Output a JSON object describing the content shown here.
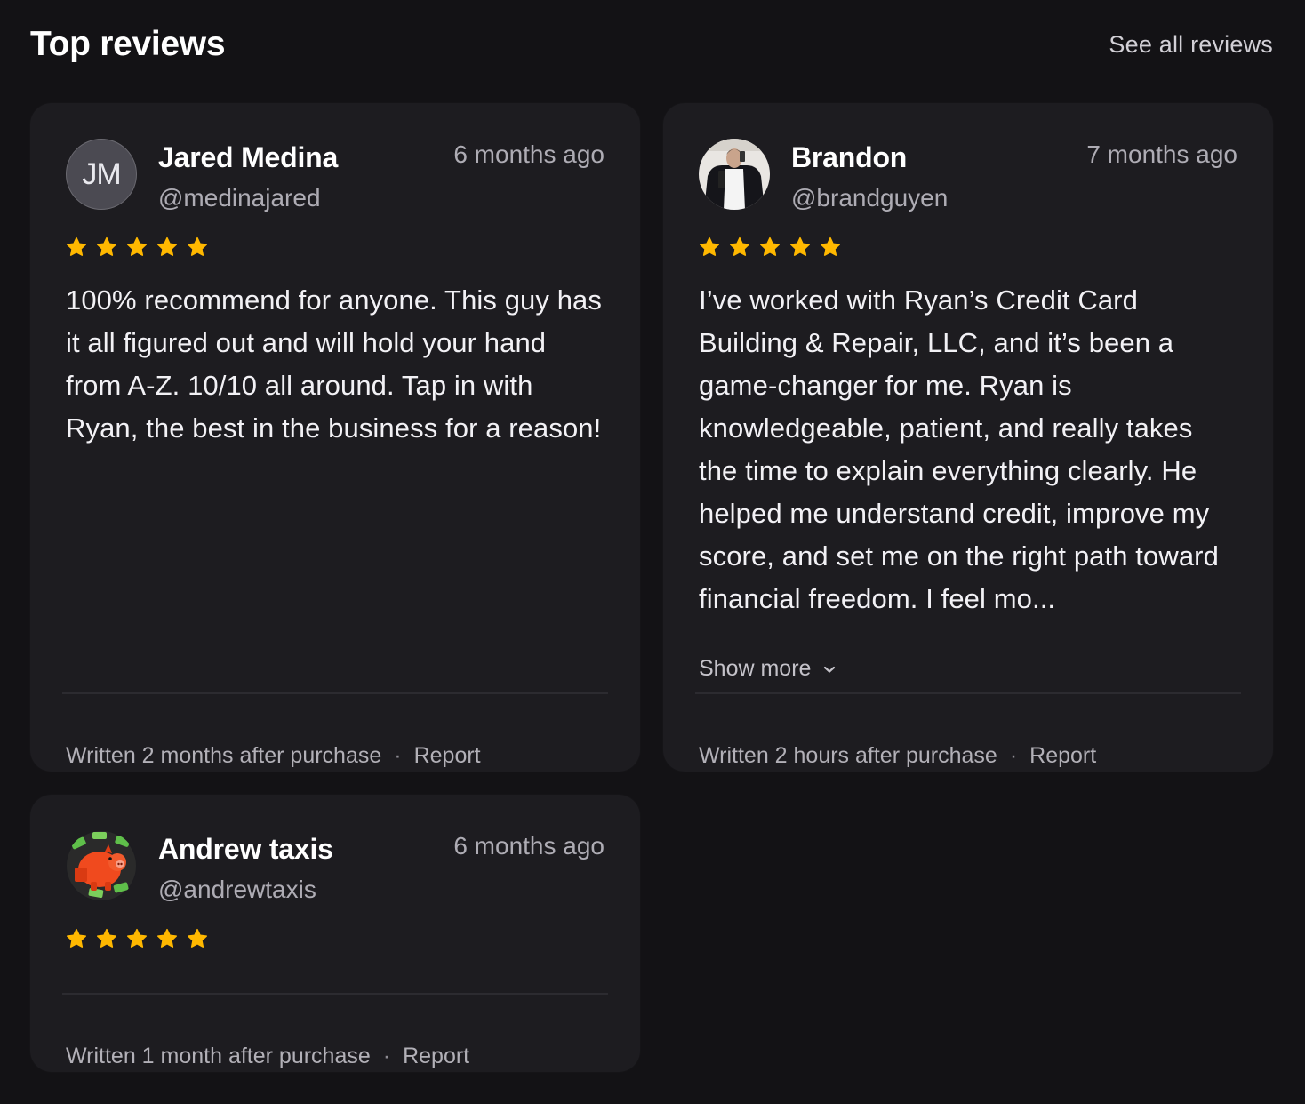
{
  "header": {
    "title": "Top reviews",
    "see_all": "See all reviews"
  },
  "reviews": [
    {
      "avatar_initials": "JM",
      "name": "Jared Medina",
      "handle": "@medinajared",
      "time": "6 months ago",
      "rating": 5,
      "text": "100% recommend for anyone. This guy has it all figured out and will hold your hand from A-Z. 10/10 all around. Tap in with Ryan, the best in the business for a reason!",
      "footer": "Written 2 months after purchase",
      "report": "Report"
    },
    {
      "avatar_initials": "",
      "name": "Brandon",
      "handle": "@brandguyen",
      "time": "7 months ago",
      "rating": 5,
      "text": "I’ve worked with Ryan’s Credit Card Building & Repair, LLC, and it’s been a game-changer for me. Ryan is knowledgeable, patient, and really takes the time to explain everything clearly. He helped me understand credit, improve my score, and set me on the right path toward financial freedom. I feel mo...",
      "show_more": "Show more",
      "footer": "Written 2 hours after purchase",
      "report": "Report"
    },
    {
      "avatar_initials": "",
      "name": "Andrew taxis",
      "handle": "@andrewtaxis",
      "time": "6 months ago",
      "rating": 5,
      "text": "",
      "footer": "Written 1 month after purchase",
      "report": "Report"
    }
  ],
  "colors": {
    "background": "#131215",
    "card": "#1d1c20",
    "star": "#ffb800",
    "muted_text": "#aeacb4"
  }
}
